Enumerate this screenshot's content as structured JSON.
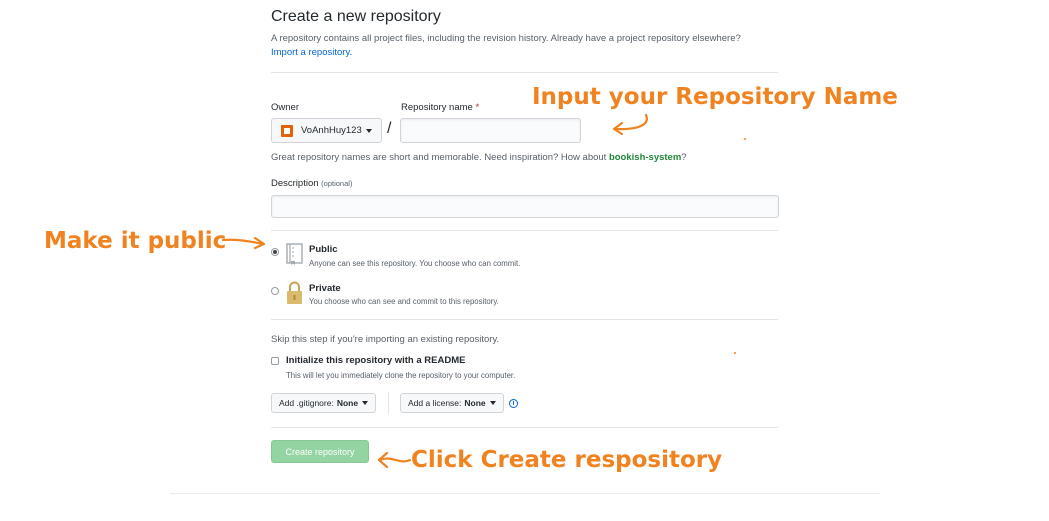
{
  "header": {
    "title": "Create a new repository",
    "subtitle": "A repository contains all project files, including the revision history. Already have a project repository elsewhere?",
    "import_link": "Import a repository."
  },
  "owner": {
    "label": "Owner",
    "value": "VoAnhHuy123",
    "icon": "avatar-icon"
  },
  "repo_name": {
    "label": "Repository name",
    "required_mark": "*",
    "value": ""
  },
  "name_help": {
    "text": "Great repository names are short and memorable. Need inspiration? How about ",
    "suggestion": "bookish-system",
    "suffix": "?"
  },
  "description": {
    "label": "Description",
    "optional": "(optional)",
    "value": ""
  },
  "visibility": {
    "public": {
      "title": "Public",
      "note": "Anyone can see this repository. You choose who can commit.",
      "selected": true
    },
    "private": {
      "title": "Private",
      "note": "You choose who can see and commit to this repository.",
      "selected": false
    }
  },
  "init": {
    "skip_text": "Skip this step if you're importing an existing repository.",
    "readme_label": "Initialize this repository with a README",
    "readme_note": "This will let you immediately clone the repository to your computer."
  },
  "gitignore": {
    "label": "Add .gitignore:",
    "value": "None"
  },
  "license": {
    "label": "Add a license:",
    "value": "None"
  },
  "create_button": "Create repository",
  "annotations": {
    "repo_name": "Input your Repository Name",
    "public": "Make it public",
    "create": "Click Create respository"
  },
  "colors": {
    "annotation": "#f0831f",
    "link": "#0366d6",
    "create_button": "#94d3a2"
  }
}
